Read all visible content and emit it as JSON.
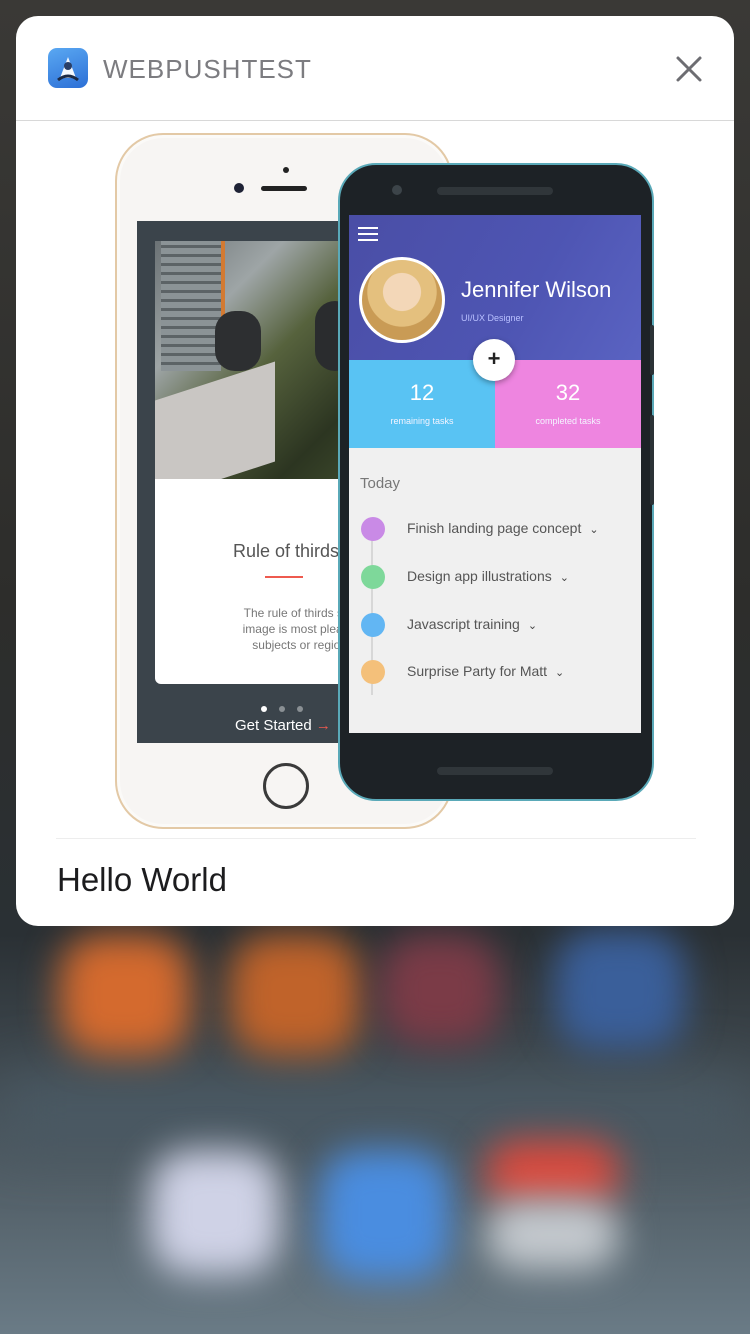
{
  "notification": {
    "app_name": "WEBPUSHTEST",
    "message": "Hello World",
    "icons": {
      "app": "app-icon",
      "close": "close-icon"
    }
  },
  "attachment": {
    "iphone_app": {
      "title": "Rule of thirds",
      "body": "The rule of thirds states th\nimage is most pleasing wh\nsubjects or regions are",
      "cta": "Get Started",
      "cta_arrow": "→"
    },
    "android_app": {
      "profile_name": "Jennifer Wilson",
      "profile_role": "UI/UX Designer",
      "fab_label": "+",
      "stats": [
        {
          "value": "12",
          "label": "remaining tasks",
          "color": "#59c3f3"
        },
        {
          "value": "32",
          "label": "completed tasks",
          "color": "#ee85e0"
        }
      ],
      "section_label": "Today",
      "tasks": [
        {
          "label": "Finish landing page concept",
          "color": "#c98ae6"
        },
        {
          "label": "Design app illustrations",
          "color": "#7ed89a"
        },
        {
          "label": "Javascript training",
          "color": "#62b6f3"
        },
        {
          "label": "Surprise Party for Matt",
          "color": "#f4c07a"
        }
      ],
      "chevron": "⌄"
    }
  }
}
